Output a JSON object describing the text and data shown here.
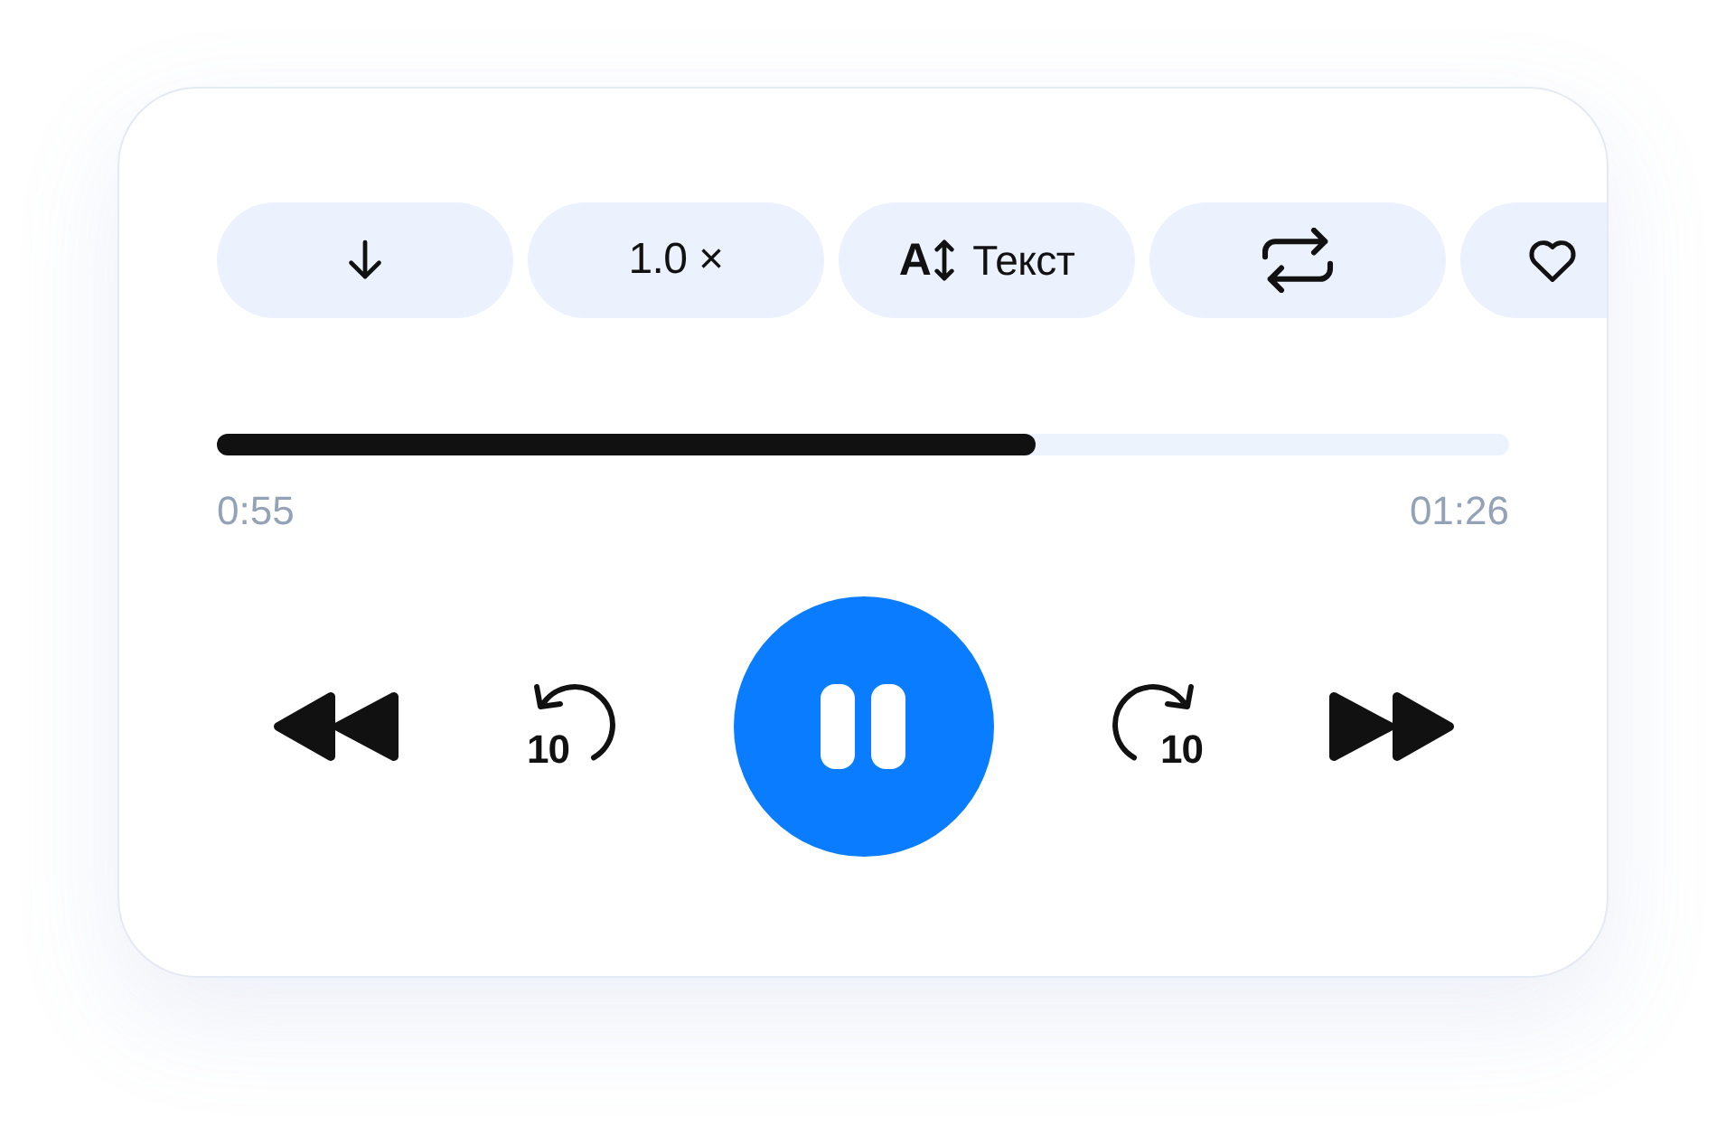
{
  "chips": [
    {
      "kind": "download"
    },
    {
      "kind": "speed",
      "label": "1.0 ×"
    },
    {
      "kind": "text_size",
      "glyph": "A",
      "label": "Текст"
    },
    {
      "kind": "repeat"
    },
    {
      "kind": "favorite"
    }
  ],
  "progress": {
    "level": 0.634,
    "elapsed": "0:55",
    "duration": "01:26"
  },
  "controls": {
    "skip_back_label": "10",
    "skip_forward_label": "10",
    "playing": true
  }
}
